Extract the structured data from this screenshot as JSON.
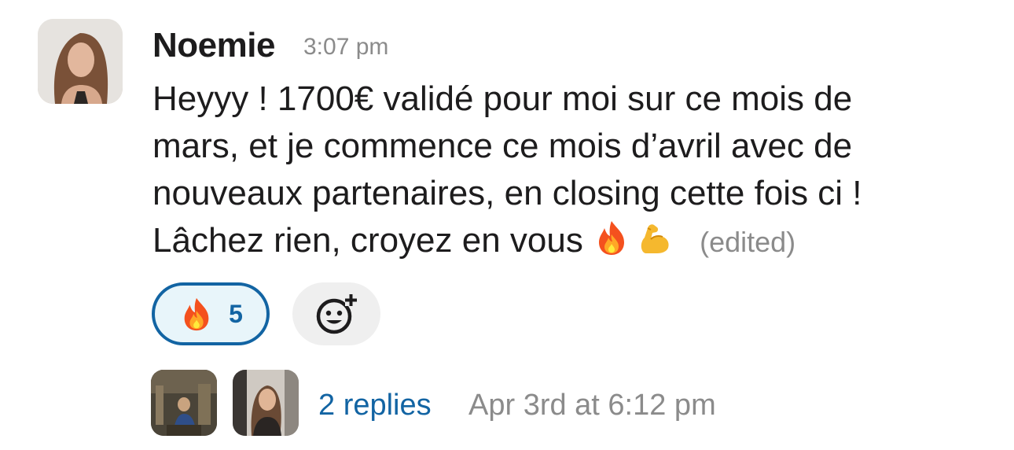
{
  "message": {
    "author": "Noemie",
    "time": "3:07 pm",
    "lines": [
      "Heyyy ! 1700€ validé pour moi sur ce mois de",
      "mars, et je commence ce mois d’avril avec de",
      "nouveaux partenaires, en closing cette fois ci !",
      "Lâchez rien, croyez en vous "
    ],
    "emojis": [
      "fire-icon",
      "flexed-biceps-icon"
    ],
    "edited_label": "(edited)"
  },
  "reactions": [
    {
      "emoji": "fire-icon",
      "count": "5",
      "selected": true
    }
  ],
  "add_reaction": {
    "icon": "add-reaction-icon"
  },
  "thread": {
    "replies_label": "2 replies",
    "last_reply": "Apr 3rd at 6:12 pm"
  },
  "colors": {
    "link": "#1264a3",
    "muted": "#8b8b8b",
    "reaction_bg": "#e8f5fa",
    "add_reaction_bg": "#efefef",
    "text": "#1d1c1d"
  }
}
